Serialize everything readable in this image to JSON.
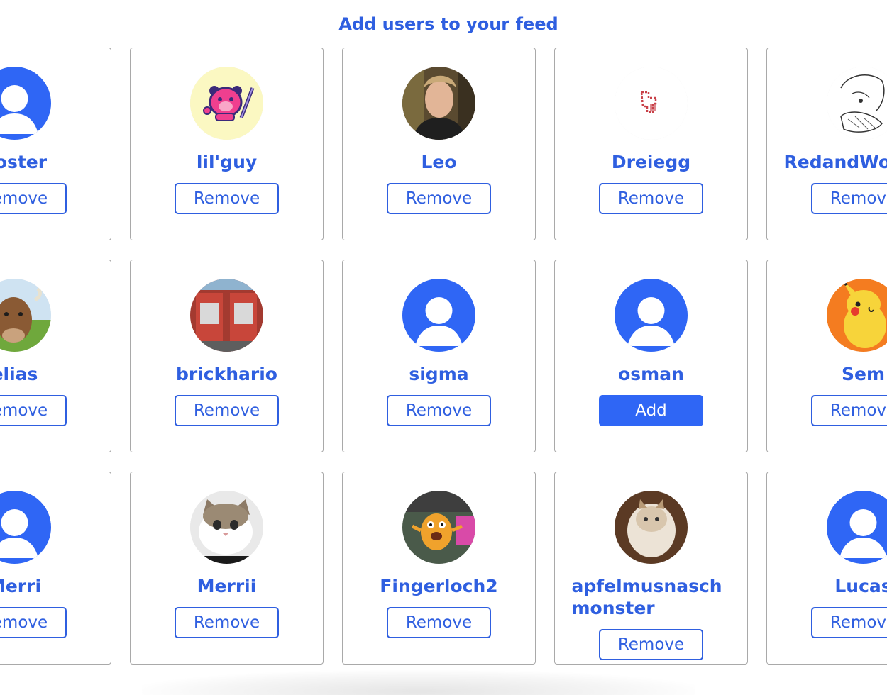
{
  "heading": "Add users to your feed",
  "colors": {
    "accent": "#2f5fe0",
    "add_button_bg": "#2f66f5",
    "card_border": "#a9a9a9"
  },
  "cards": [
    {
      "username": "poster",
      "button": "Remove",
      "avatar": "default-avatar-icon"
    },
    {
      "username": "lil'guy",
      "button": "Remove",
      "avatar": "pink-bear-knight-avatar"
    },
    {
      "username": "Leo",
      "button": "Remove",
      "avatar": "person-photo-avatar"
    },
    {
      "username": "Dreiegg",
      "button": "Remove",
      "avatar": "red-pixel-sketch-avatar"
    },
    {
      "username": "RedandWoocial",
      "button": "Remove",
      "avatar": "sketch-drawing-avatar"
    },
    {
      "username": "elias",
      "button": "Remove",
      "avatar": "cow-photo-avatar"
    },
    {
      "username": "brickhario",
      "button": "Remove",
      "avatar": "red-machines-photo-avatar"
    },
    {
      "username": "sigma",
      "button": "Remove",
      "avatar": "default-avatar-icon"
    },
    {
      "username": "osman",
      "button": "Add",
      "avatar": "default-avatar-icon"
    },
    {
      "username": "Sem",
      "button": "Remove",
      "avatar": "pikachu-avatar"
    },
    {
      "username": "Merri",
      "button": "Remove",
      "avatar": "default-avatar-icon"
    },
    {
      "username": "Merrii",
      "button": "Remove",
      "avatar": "cat-photo-avatar"
    },
    {
      "username": "Fingerloch2",
      "button": "Remove",
      "avatar": "cartoon-dog-avatar"
    },
    {
      "username": "apfelmusnaschmonster",
      "button": "Remove",
      "avatar": "fluffy-cat-photo-avatar"
    },
    {
      "username": "Lucas",
      "button": "Remove",
      "avatar": "default-avatar-icon"
    }
  ]
}
